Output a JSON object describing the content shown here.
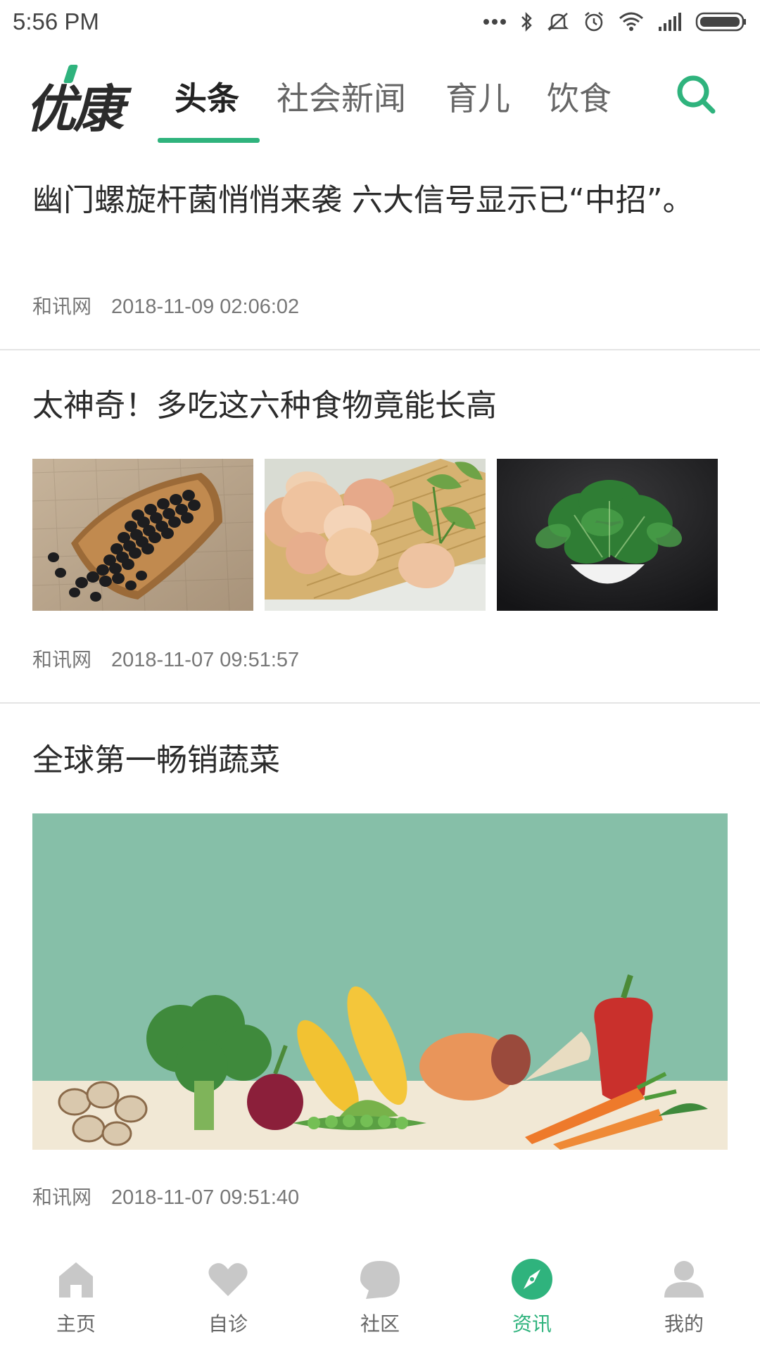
{
  "status_bar": {
    "time": "5:56 PM",
    "icons": [
      "more-dots-icon",
      "bluetooth-icon",
      "mute-icon",
      "alarm-icon",
      "wifi-icon",
      "signal-icon",
      "battery-icon"
    ]
  },
  "header": {
    "logo": "优康",
    "tabs": [
      {
        "label": "头条",
        "active": true
      },
      {
        "label": "社会新闻",
        "active": false
      },
      {
        "label": "育儿",
        "active": false
      },
      {
        "label": "饮食",
        "active": false
      }
    ],
    "search_icon": "search-icon"
  },
  "articles": [
    {
      "title": "幽门螺旋杆菌悄悄来袭 六大信号显示已“中招”。",
      "source": "和讯网",
      "time": "2018-11-09 02:06:02"
    },
    {
      "title": "太神奇！多吃这六种食物竟能长高",
      "source": "和讯网",
      "time": "2018-11-07 09:51:57",
      "images": [
        "black-beans-image",
        "eggs-basket-image",
        "spinach-bowl-image"
      ]
    },
    {
      "title": "全球第一畅销蔬菜",
      "source": "和讯网",
      "time": "2018-11-07 09:51:40",
      "images": [
        "vegetables-illustration-image"
      ]
    }
  ],
  "bottom_nav": [
    {
      "label": "主页",
      "icon": "home-icon",
      "active": false
    },
    {
      "label": "自诊",
      "icon": "heart-icon",
      "active": false
    },
    {
      "label": "社区",
      "icon": "chat-bubble-icon",
      "active": false
    },
    {
      "label": "资讯",
      "icon": "compass-icon",
      "active": true
    },
    {
      "label": "我的",
      "icon": "person-icon",
      "active": false
    }
  ],
  "colors": {
    "accent": "#2fb37d",
    "nav_inactive": "#c8c8c8",
    "title_text": "#2b2b2b",
    "meta_text": "#777777"
  }
}
